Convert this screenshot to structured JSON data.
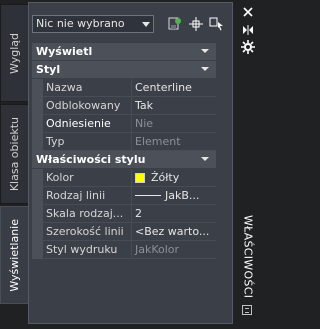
{
  "side_tabs": [
    {
      "label": "Wygląd",
      "active": false
    },
    {
      "label": "Klasa obiektu",
      "active": false
    },
    {
      "label": "Wyświetlanie",
      "active": true
    }
  ],
  "palette_title": "WŁAŚCIWOŚCI",
  "selection": {
    "value": "Nic nie wybrano"
  },
  "toolbar_icons": [
    "select-objects-icon",
    "pick-point-icon",
    "quick-select-icon"
  ],
  "titlebar_icons": [
    "close-icon",
    "auto-hide-icon",
    "settings-icon",
    "palette-menu-icon"
  ],
  "categories": [
    {
      "name": "Wyświetl",
      "rows": []
    },
    {
      "name": "Styl",
      "rows": [
        {
          "name": "Nazwa",
          "value": "Centerline"
        },
        {
          "name": "Odblokowany",
          "value": "Tak"
        },
        {
          "name": "Odniesienie",
          "value": "Nie",
          "disabled": true,
          "highlight": true
        },
        {
          "name": "Typ",
          "value": "Element",
          "disabled": true
        }
      ]
    },
    {
      "name": "Właściwości stylu",
      "rows": [
        {
          "name": "Kolor",
          "value": "Żółty",
          "swatch_color": "#ffff00"
        },
        {
          "name": "Rodzaj linii",
          "value": "JakB...",
          "linetype": true
        },
        {
          "name": "Skala rodzaj...",
          "value": "2"
        },
        {
          "name": "Szerokość linii",
          "value": "<Bez warto..."
        },
        {
          "name": "Styl wydruku",
          "value": "JakKolor",
          "disabled": true
        }
      ]
    }
  ]
}
